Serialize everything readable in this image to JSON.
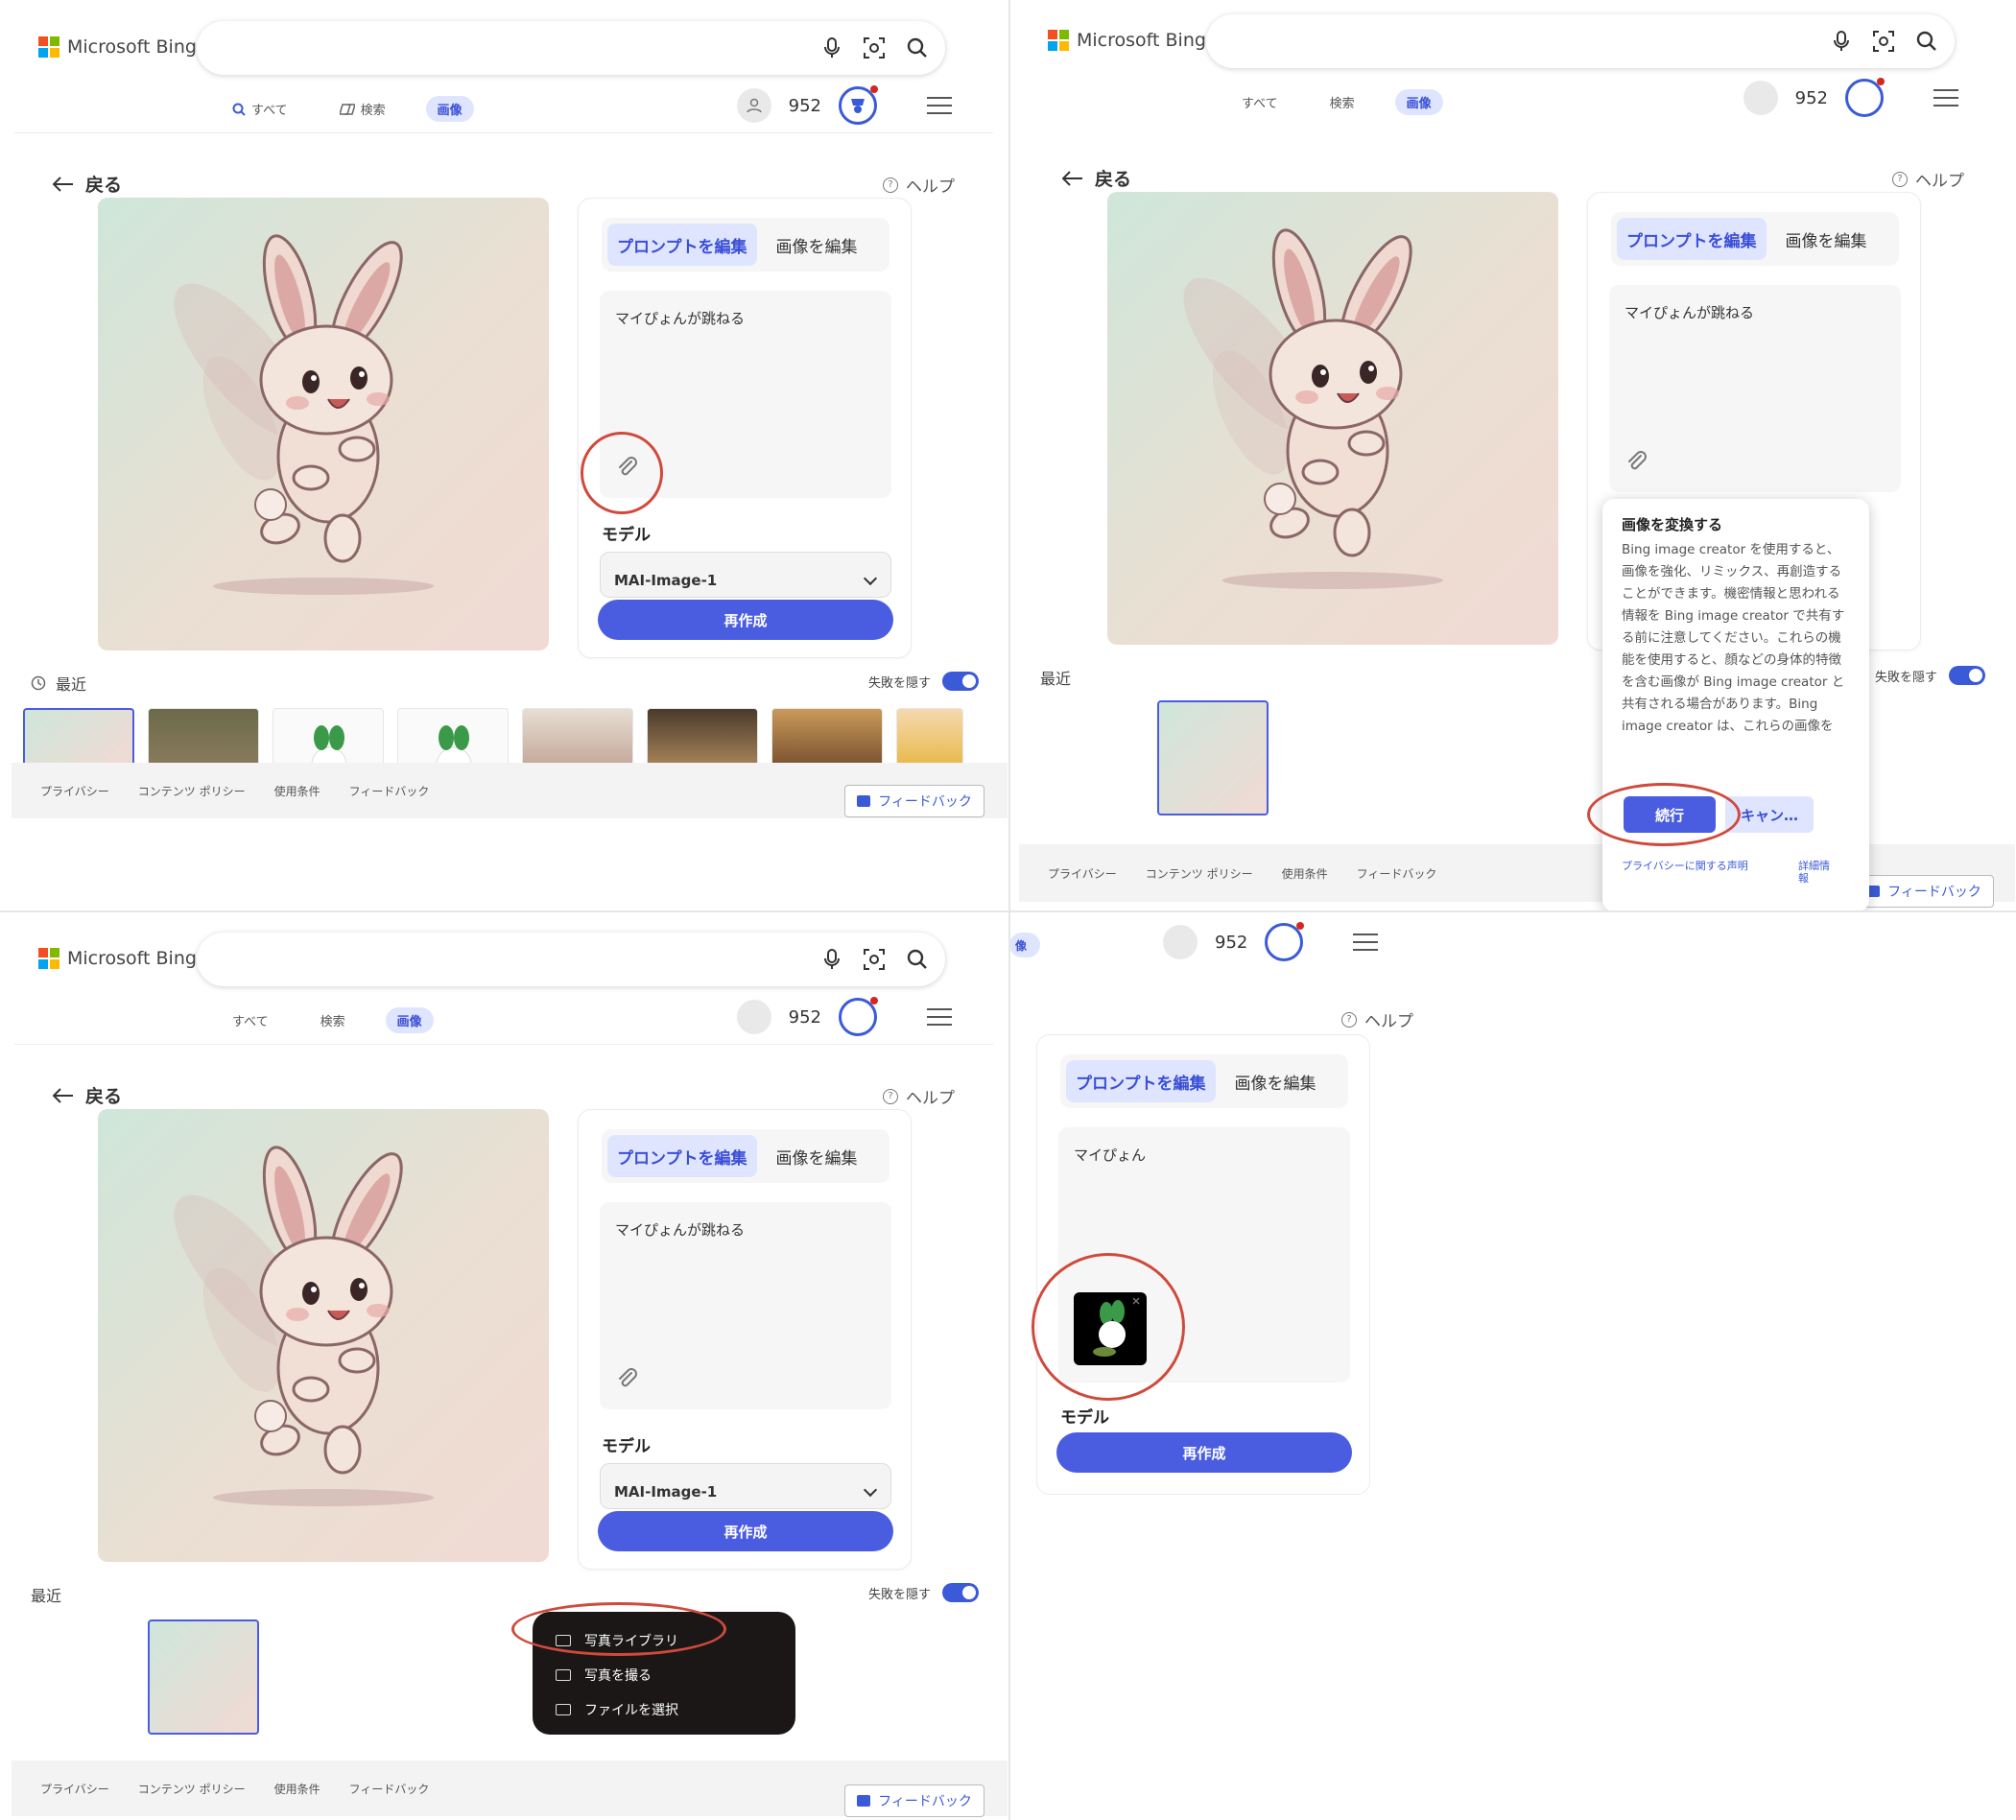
{
  "brand": "Microsoft Bing",
  "colors": {
    "accent": "#4a5de0",
    "highlight": "#cf4a3d",
    "tab_active_bg": "#dfe5ff"
  },
  "nav": {
    "all": "すべて",
    "search": "検索",
    "images": "画像",
    "images_short": "像"
  },
  "header": {
    "points": "952"
  },
  "back": "戻る",
  "help": "ヘルプ",
  "panel": {
    "tab_prompt": "プロンプトを編集",
    "tab_image": "画像を編集",
    "prompt_text": "マイぴょんが跳ねる",
    "prompt_text_short": "マイぴょん",
    "model_label": "モデル",
    "model_value": "MAI-Image-1",
    "recreate": "再作成"
  },
  "recent": "最近",
  "hide_fail": "失敗を隠す",
  "footer": {
    "privacy": "プライバシー",
    "content_policy": "コンテンツ ポリシー",
    "terms": "使用条件",
    "feedback_link": "フィードバック",
    "feedback_btn": "フィードバック"
  },
  "popup": {
    "title": "画像を変換する",
    "body": "Bing image creator を使用すると、画像を強化、リミックス、再創造することができます。機密情報と思われる情報を Bing image creator で共有する前に注意してください。これらの機能を使用すると、顔などの身体的特徴を含む画像が Bing image creator と共有される場合があります。Bing image creator は、これらの画像を使…",
    "continue": "続行",
    "cancel": "キャン…",
    "privacy_link": "プライバシーに関する声明",
    "details_link": "詳細情報"
  },
  "menu": {
    "library": "写真ライブラリ",
    "take_photo": "写真を撮る",
    "choose_file": "ファイルを選択"
  }
}
